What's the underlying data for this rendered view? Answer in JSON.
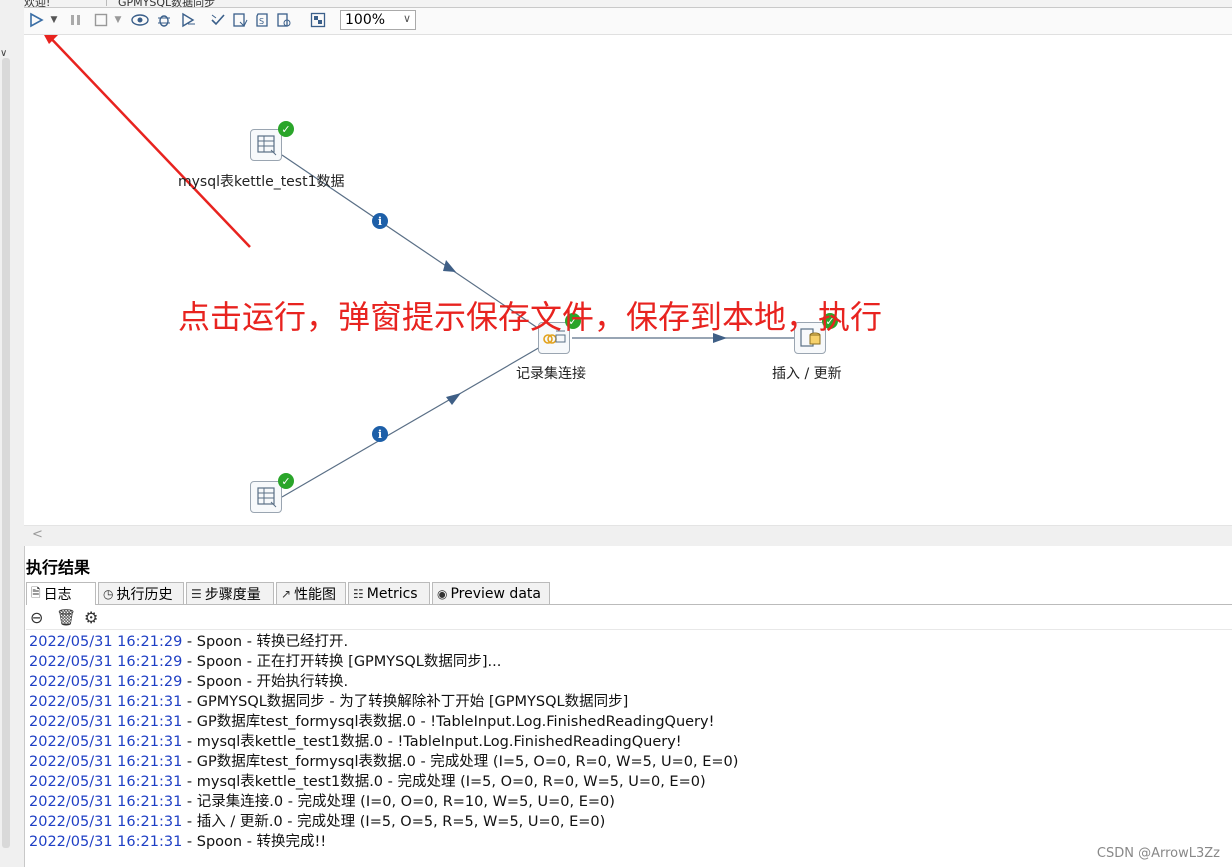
{
  "tabs": [
    "欢迎!",
    "GPMYSQL数据同步"
  ],
  "toolbar": {
    "zoom": "100%"
  },
  "canvas": {
    "nodes": [
      {
        "label": "mysql表kettle_test1数据"
      },
      {
        "label": "记录集连接"
      },
      {
        "label": "插入 / 更新"
      },
      {
        "label": ""
      }
    ],
    "annotation": "点击运行，弹窗提示保存文件，保存到本地，执行"
  },
  "results": {
    "title": "执行结果",
    "tabs": [
      {
        "label": "日志",
        "icon": "log-icon"
      },
      {
        "label": "执行历史",
        "icon": "history-icon"
      },
      {
        "label": "步骤度量",
        "icon": "steps-metrics-icon"
      },
      {
        "label": "性能图",
        "icon": "perf-graph-icon"
      },
      {
        "label": "Metrics",
        "icon": "metrics-icon"
      },
      {
        "label": "Preview data",
        "icon": "eye-icon"
      }
    ],
    "log": [
      {
        "ts": "2022/05/31 16:21:29",
        "msg": " - Spoon - 转换已经打开."
      },
      {
        "ts": "2022/05/31 16:21:29",
        "msg": " - Spoon - 正在打开转换 [GPMYSQL数据同步]..."
      },
      {
        "ts": "2022/05/31 16:21:29",
        "msg": " - Spoon - 开始执行转换."
      },
      {
        "ts": "2022/05/31 16:21:31",
        "msg": " - GPMYSQL数据同步 - 为了转换解除补丁开始  [GPMYSQL数据同步]"
      },
      {
        "ts": "2022/05/31 16:21:31",
        "msg": " - GP数据库test_formysql表数据.0 - !TableInput.Log.FinishedReadingQuery!"
      },
      {
        "ts": "2022/05/31 16:21:31",
        "msg": " - mysql表kettle_test1数据.0 - !TableInput.Log.FinishedReadingQuery!"
      },
      {
        "ts": "2022/05/31 16:21:31",
        "msg": " - GP数据库test_formysql表数据.0 - 完成处理 (I=5, O=0, R=0, W=5, U=0, E=0)"
      },
      {
        "ts": "2022/05/31 16:21:31",
        "msg": " - mysql表kettle_test1数据.0 - 完成处理 (I=5, O=0, R=0, W=5, U=0, E=0)"
      },
      {
        "ts": "2022/05/31 16:21:31",
        "msg": " - 记录集连接.0 - 完成处理 (I=0, O=0, R=10, W=5, U=0, E=0)"
      },
      {
        "ts": "2022/05/31 16:21:31",
        "msg": " - 插入 / 更新.0 - 完成处理 (I=5, O=5, R=5, W=5, U=0, E=0)"
      },
      {
        "ts": "2022/05/31 16:21:31",
        "msg": " - Spoon - 转换完成!!"
      }
    ]
  },
  "watermark": "CSDN @ArrowL3Zz",
  "colors": {
    "annotation": "#e8231f",
    "timestamp": "#1e3fc4",
    "ok": "#2aa52a",
    "info": "#1d5fa8"
  }
}
